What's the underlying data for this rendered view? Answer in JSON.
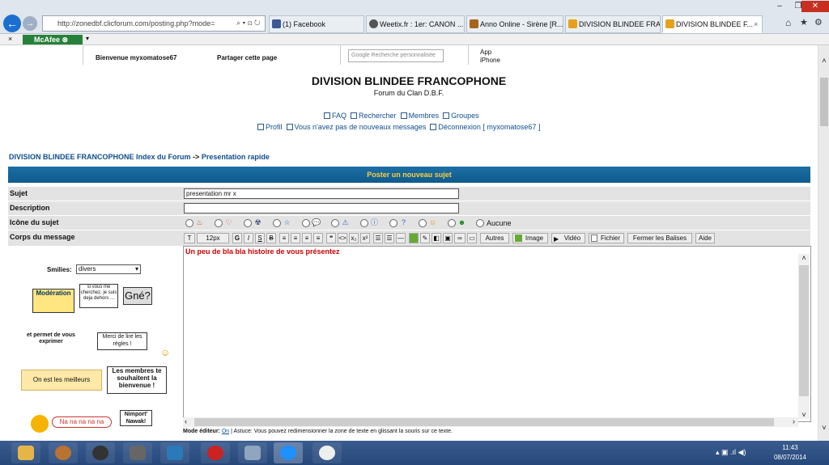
{
  "browser": {
    "address": "http://zonedbf.clicforum.com/posting.php?mode=",
    "tabs": [
      "(1) Facebook",
      "Weetix.fr : 1er: CANON ...",
      "Anno Online - Sirène [R...",
      "DIVISION BLINDEE FRA...",
      "DIVISION BLINDEE F..."
    ],
    "mcafee": "McAfee"
  },
  "topnav": {
    "welcome": "Bienvenue myxomatose67",
    "share": "Partager cette page",
    "search_placeholder": "Recherche personnalisée",
    "search_brand": "Google",
    "app_line1": "App",
    "app_line2": "iPhone"
  },
  "site": {
    "title": "DIVISION BLINDEE FRANCOPHONE",
    "subtitle": "Forum du Clan D.B.F.",
    "links": [
      "FAQ",
      "Rechercher",
      "Membres",
      "Groupes"
    ],
    "links2": [
      "Profil",
      "Vous n'avez pas de nouveaux messages",
      "Déconnexion [ myxomatose67 ]"
    ]
  },
  "breadcrumb": {
    "index": "DIVISION BLINDEE FRANCOPHONE Index du Forum",
    "sep": "->",
    "current": "Presentation rapide"
  },
  "form": {
    "header": "Poster un nouveau sujet",
    "subject_label": "Sujet",
    "subject_value": "presentation mr x",
    "description_label": "Description",
    "icon_label": "Icône du sujet",
    "icon_none": "Aucune",
    "body_label": "Corps du message",
    "smilies_label": "Smilies:",
    "smilies_value": "divers",
    "message_text": "Un peu de bla bla histoire de vous présentez",
    "editor_mode_label": "Mode éditeur:",
    "editor_mode_value": "On",
    "tip": "| Astuce: Vous pouvez redimensionner la zone de texte en glissant la souris sur ce texte."
  },
  "toolbar": {
    "font_size": "12px",
    "buttons": [
      "Autres",
      "Image",
      "Vidéo",
      "Fichier",
      "Fermer les Balises",
      "Aide"
    ]
  },
  "smilies": {
    "moderation": "Modération",
    "cherchez": "si vous me cherchez, je suis deja dehors ...",
    "gne": "Gné?",
    "permet": "et permet de vous exprimer",
    "regles": "Merci de lire les règles !",
    "meilleurs": "On est les meilleurs",
    "membres": "Les membres te souhaitent la bienvenue !",
    "nanana": "Na na na na na",
    "nimport": "Nimport' Nawak!"
  },
  "taskbar": {
    "time": "11:43",
    "date": "08/07/2014"
  },
  "colors": {
    "header": "#1b6fa6",
    "header_text": "#ffcc44",
    "link": "#114d8c",
    "message": "#cc0000"
  }
}
